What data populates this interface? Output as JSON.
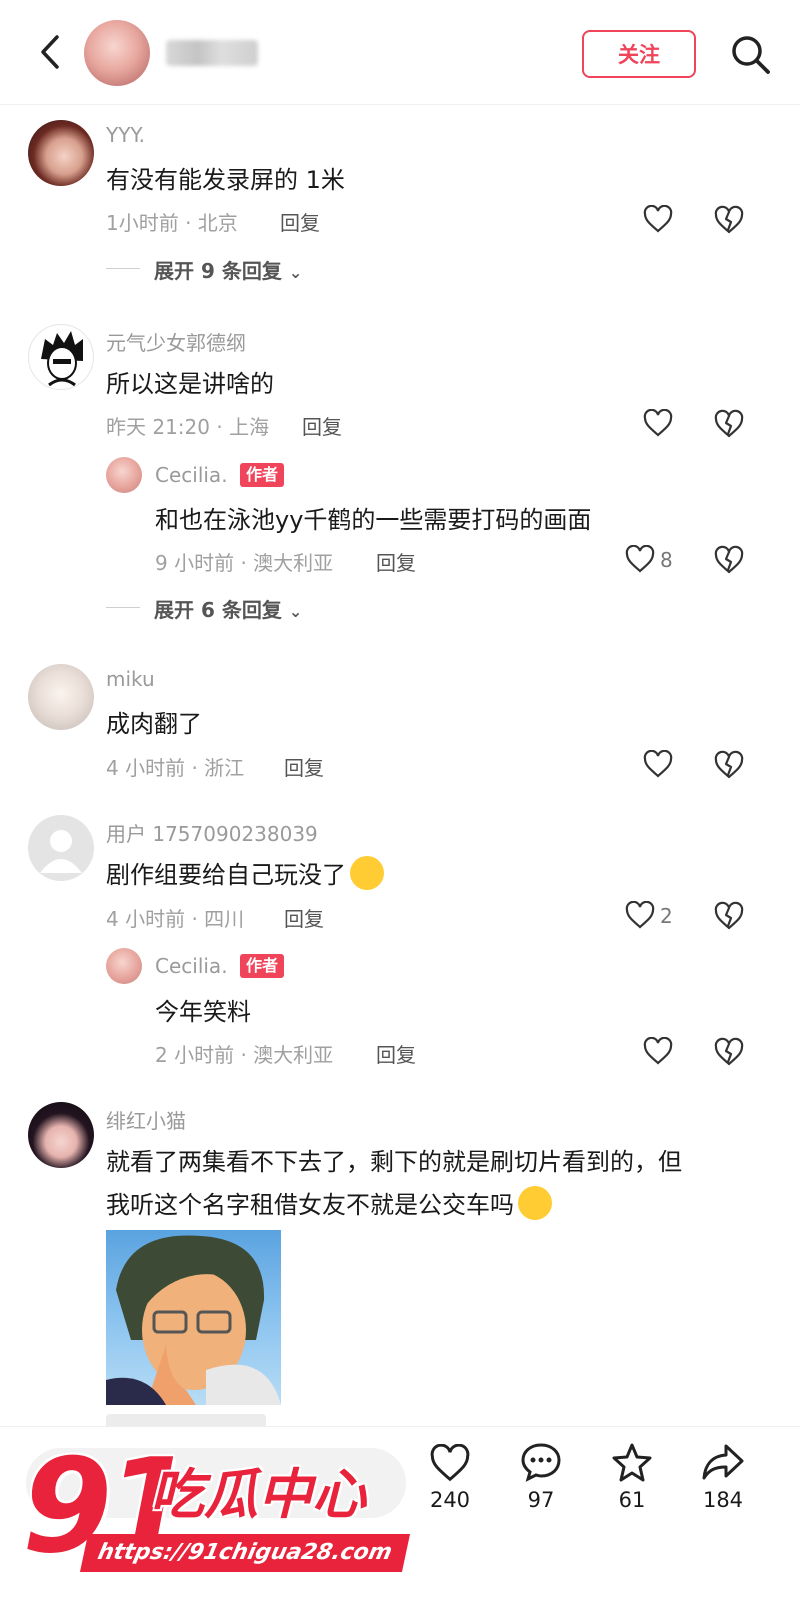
{
  "header": {
    "follow_label": "关注"
  },
  "comments": [
    {
      "user": "YYY.",
      "text": "有没有能发录屏的 1米",
      "meta": "1小时前 · 北京",
      "reply_label": "回复",
      "expand_label": "展开 9 条回复"
    },
    {
      "user": "元气少女郭德纲",
      "text": "所以这是讲啥的",
      "meta": "昨天 21:20 · 上海",
      "reply_label": "回复",
      "sub": {
        "user": "Cecilia.",
        "badge": "作者",
        "text": "和也在泳池yy千鹤的一些需要打码的画面",
        "meta": "9 小时前 · 澳大利亚",
        "reply_label": "回复",
        "likes": "8"
      },
      "expand_label": "展开 6 条回复"
    },
    {
      "user": "miku",
      "text": "成肉翻了",
      "meta": "4 小时前 · 浙江",
      "reply_label": "回复"
    },
    {
      "user": "用户 1757090238039",
      "text": "剧作组要给自己玩没了",
      "meta": "4 小时前 · 四川",
      "reply_label": "回复",
      "likes": "2",
      "sub": {
        "user": "Cecilia.",
        "badge": "作者",
        "text": "今年笑料",
        "meta": "2 小时前 · 澳大利亚",
        "reply_label": "回复"
      }
    },
    {
      "user": "绯红小猫",
      "text_line1": "就看了两集看不下去了，剩下的就是刷切片看到的，但",
      "text_line2": "我听这个名字租借女友不就是公交车吗"
    }
  ],
  "bottom": {
    "likes": "240",
    "comments": "97",
    "favorites": "61",
    "shares": "184"
  },
  "watermark": {
    "big": "91",
    "text": "吃瓜中心",
    "url": "https://91chigua28.com"
  },
  "colors": {
    "accent": "#f0445a",
    "watermark": "#e8233b"
  }
}
